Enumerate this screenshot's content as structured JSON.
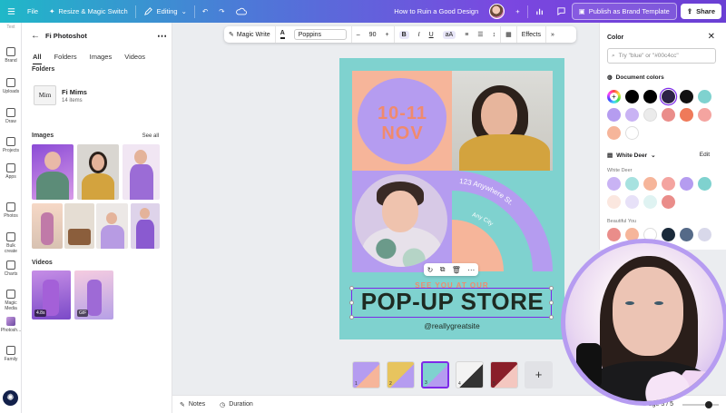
{
  "topbar": {
    "file": "File",
    "resize": "Resize & Magic Switch",
    "mode": "Editing",
    "doc_title": "How to Ruin a Good Design",
    "publish": "Publish as Brand Template",
    "share": "Share"
  },
  "rail": {
    "items": [
      "Brand",
      "Uploads",
      "Draw",
      "Projects",
      "Apps",
      "Photos",
      "Bulk create",
      "Charts",
      "Magic Media",
      "Photosh...",
      "Family"
    ]
  },
  "panel": {
    "title": "Fi Photoshot",
    "tabs": [
      "All",
      "Folders",
      "Images",
      "Videos"
    ],
    "folders_heading": "Folders",
    "folder_name": "Fi Mims",
    "folder_count": "14 items",
    "folder_thumb_text": "Mim",
    "images_heading": "Images",
    "see_all": "See all",
    "videos_heading": "Videos",
    "video_badges": [
      "4.8s",
      "GIF"
    ]
  },
  "toolbar": {
    "magic_write": "Magic Write",
    "font": "Poppins",
    "size": "90",
    "minus": "–",
    "plus": "+",
    "bold": "B",
    "italic": "I",
    "underline": "U",
    "case": "aA",
    "effects": "Effects"
  },
  "design": {
    "date": "10-11",
    "month": "NOV",
    "address": "123 Anywhere St.",
    "city": "Any City",
    "see_you": "SEE YOU AT OUR",
    "headline": "POP-UP STORE",
    "handle": "@reallygreatsite"
  },
  "footer": {
    "notes": "Notes",
    "duration": "Duration",
    "page_indicator": "Page 3 / 5",
    "zoom_fraction": 0.72
  },
  "pages": [
    {
      "num": "1",
      "colors": [
        "#b59cf0",
        "#f6b59a"
      ]
    },
    {
      "num": "2",
      "colors": [
        "#e7c45e",
        "#b59cf0"
      ]
    },
    {
      "num": "3",
      "colors": [
        "#7fd2cf",
        "#b59cf0"
      ]
    },
    {
      "num": "4",
      "colors": [
        "#f3f3f3",
        "#333333"
      ]
    },
    {
      "num": "5",
      "colors": [
        "#8a1f2a",
        "#f4c7c0"
      ]
    }
  ],
  "color_panel": {
    "title": "Color",
    "search_placeholder": "Try \"blue\" or \"#00c4cc\"",
    "document_colors": "Document colors",
    "brand_kit": "White Deer",
    "edit": "Edit",
    "palette1_name": "White Deer",
    "palette2_name": "Beautiful You",
    "doc_swatches": [
      "#000000",
      "#000000",
      "#2d2346",
      "#111111",
      "#7fd2cf",
      "#b59cf0",
      "#c9b3f4",
      "#ebebeb",
      "#ea8d8a",
      "#ef7a5a",
      "#f4a4a0",
      "#f6b59a",
      "#ffffff"
    ],
    "palette1": [
      "#c9b3f4",
      "#a7e2e0",
      "#f6b59a",
      "#f4a4a0",
      "#b59cf0",
      "#7fd2cf",
      "#fbe7df",
      "#e7e1f8",
      "#dff3f2",
      "#ea8d8a"
    ],
    "palette2": [
      "#ea8d8a",
      "#f6b59a",
      "#ffffff",
      "#1a2a3a",
      "#556a88",
      "#d8d8ea"
    ]
  }
}
